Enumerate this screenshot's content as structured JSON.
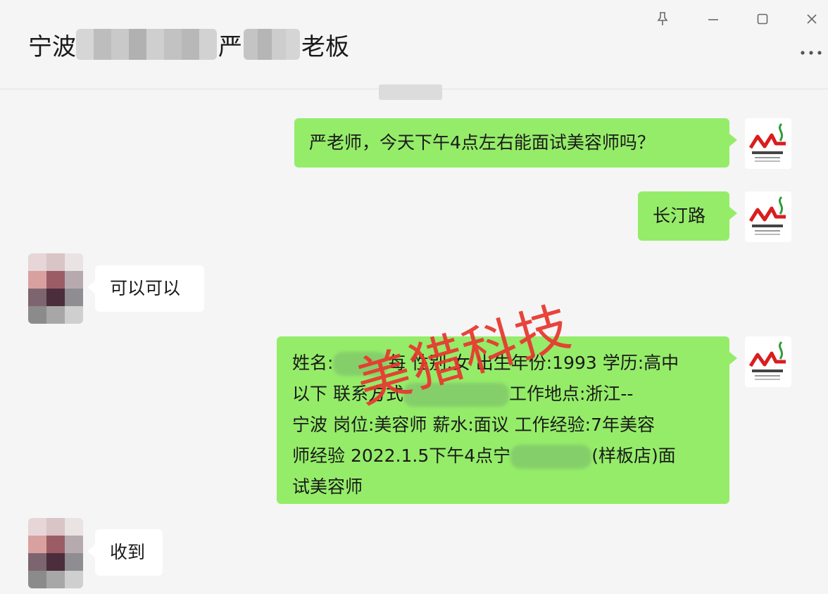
{
  "header": {
    "title_prefix": "宁波",
    "title_mid": "严",
    "title_suffix": "老板"
  },
  "window_controls": {
    "pin_icon": "pin-icon",
    "minimize_icon": "minimize-icon",
    "maximize_icon": "maximize-icon",
    "close_icon": "close-icon",
    "more_icon": "more-options-icon"
  },
  "messages": [
    {
      "side": "right",
      "text": "严老师，今天下午4点左右能面试美容师吗？"
    },
    {
      "side": "right",
      "text": "长汀路"
    },
    {
      "side": "left",
      "text": "可以可以"
    },
    {
      "side": "right",
      "lines": [
        {
          "a": "姓名:",
          "b": "每 性别:女 出生年份:1993 学历:高中"
        },
        {
          "a": "以下 联系方式",
          "b": "工作地点:浙江--"
        },
        {
          "a": "宁波 岗位:美容师 薪水:面议 工作经验:7年美容"
        },
        {
          "a": "师经验 2022.1.5下午4点宁",
          "b": "(样板店)面"
        },
        {
          "a": "试美容师"
        }
      ]
    },
    {
      "side": "left",
      "text": "收到"
    }
  ],
  "watermark": "美猎科技",
  "colors": {
    "outgoing_bubble": "#95ec69",
    "incoming_bubble": "#ffffff",
    "background": "#f5f5f5",
    "watermark": "#e8372f"
  }
}
